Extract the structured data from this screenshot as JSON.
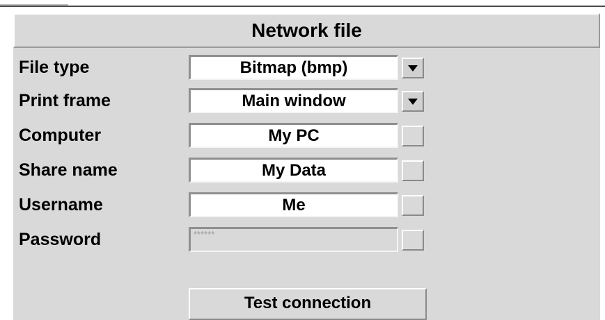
{
  "title": "Network file",
  "fields": {
    "file_type": {
      "label": "File type",
      "value": "Bitmap (bmp)"
    },
    "print_frame": {
      "label": "Print frame",
      "value": "Main window"
    },
    "computer": {
      "label": "Computer",
      "value": "My PC"
    },
    "share_name": {
      "label": "Share name",
      "value": "My Data"
    },
    "username": {
      "label": "Username",
      "value": "Me"
    },
    "password": {
      "label": "Password",
      "value": "******"
    }
  },
  "test_button_label": "Test connection"
}
